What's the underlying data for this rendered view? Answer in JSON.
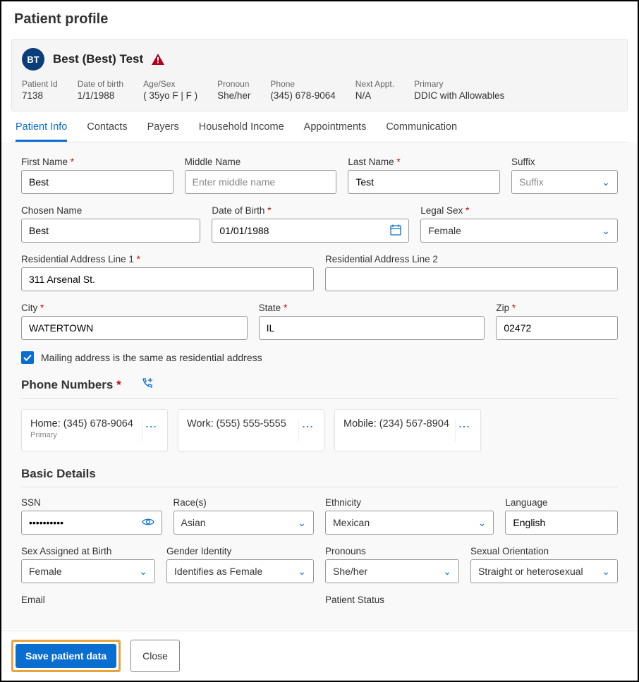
{
  "page_title": "Patient profile",
  "avatar_initials": "BT",
  "patient_name": "Best (Best) Test",
  "meta": [
    {
      "label": "Patient Id",
      "value": "7138"
    },
    {
      "label": "Date of birth",
      "value": "1/1/1988"
    },
    {
      "label": "Age/Sex",
      "value": "( 35yo F | F )"
    },
    {
      "label": "Pronoun",
      "value": "She/her"
    },
    {
      "label": "Phone",
      "value": "(345) 678-9064"
    },
    {
      "label": "Next Appt.",
      "value": "N/A"
    },
    {
      "label": "Primary",
      "value": "DDIC with Allowables"
    }
  ],
  "tabs": [
    {
      "label": "Patient Info",
      "active": true
    },
    {
      "label": "Contacts",
      "active": false
    },
    {
      "label": "Payers",
      "active": false
    },
    {
      "label": "Household Income",
      "active": false
    },
    {
      "label": "Appointments",
      "active": false
    },
    {
      "label": "Communication",
      "active": false
    }
  ],
  "fields": {
    "first_name_label": "First Name",
    "first_name_value": "Best",
    "middle_name_label": "Middle Name",
    "middle_name_placeholder": "Enter middle name",
    "last_name_label": "Last Name",
    "last_name_value": "Test",
    "suffix_label": "Suffix",
    "suffix_placeholder": "Suffix",
    "chosen_name_label": "Chosen Name",
    "chosen_name_value": "Best",
    "dob_label": "Date of Birth",
    "dob_value": "01/01/1988",
    "legal_sex_label": "Legal Sex",
    "legal_sex_value": "Female",
    "addr1_label": "Residential Address Line 1",
    "addr1_value": "311 Arsenal St.",
    "addr2_label": "Residential Address Line 2",
    "addr2_value": "",
    "city_label": "City",
    "city_value": "WATERTOWN",
    "state_label": "State",
    "state_value": "IL",
    "zip_label": "Zip",
    "zip_value": "02472",
    "mailing_same_label": "Mailing address is the same as residential address",
    "ssn_label": "SSN",
    "ssn_value": "••••••••••",
    "races_label": "Race(s)",
    "races_value": "Asian",
    "ethnicity_label": "Ethnicity",
    "ethnicity_value": "Mexican",
    "language_label": "Language",
    "language_value": "English",
    "sex_at_birth_label": "Sex Assigned at Birth",
    "sex_at_birth_value": "Female",
    "gender_identity_label": "Gender Identity",
    "gender_identity_value": "Identifies as Female",
    "pronouns_label": "Pronouns",
    "pronouns_value": "She/her",
    "sexual_orientation_label": "Sexual Orientation",
    "sexual_orientation_value": "Straight or heterosexual",
    "email_label": "Email",
    "patient_status_label": "Patient Status"
  },
  "sections": {
    "phones_title": "Phone Numbers",
    "basic_details_title": "Basic Details"
  },
  "phones": [
    {
      "type": "Home",
      "number": "(345) 678-9064",
      "sub": "Primary"
    },
    {
      "type": "Work",
      "number": "(555) 555-5555",
      "sub": ""
    },
    {
      "type": "Mobile",
      "number": "(234) 567-8904",
      "sub": ""
    }
  ],
  "footer": {
    "save_label": "Save patient data",
    "close_label": "Close"
  }
}
